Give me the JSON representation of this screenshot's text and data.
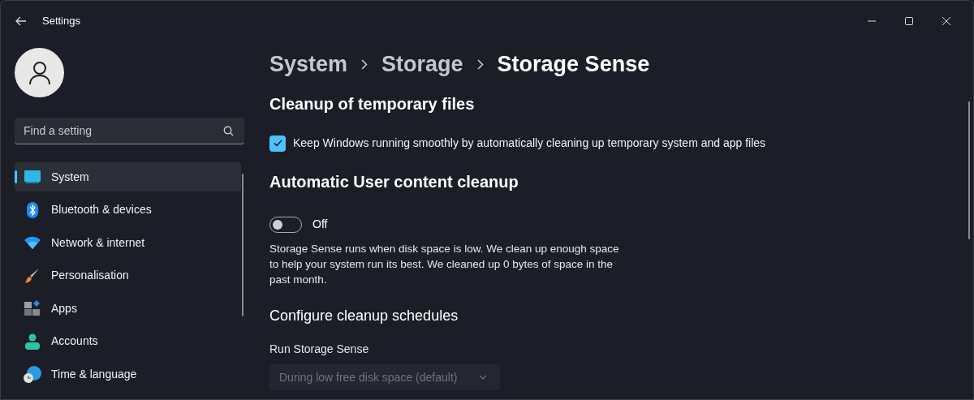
{
  "window": {
    "title": "Settings"
  },
  "search": {
    "placeholder": "Find a setting"
  },
  "nav": [
    {
      "label": "System",
      "selected": true
    },
    {
      "label": "Bluetooth & devices",
      "selected": false
    },
    {
      "label": "Network & internet",
      "selected": false
    },
    {
      "label": "Personalisation",
      "selected": false
    },
    {
      "label": "Apps",
      "selected": false
    },
    {
      "label": "Accounts",
      "selected": false
    },
    {
      "label": "Time & language",
      "selected": false
    }
  ],
  "breadcrumb": [
    "System",
    "Storage",
    "Storage Sense"
  ],
  "sections": [
    {
      "kind": "heading",
      "text": "Cleanup of temporary files"
    },
    {
      "kind": "checkbox",
      "label": "Keep Windows running smoothly by automatically cleaning up temporary system and app files",
      "checked": true
    },
    {
      "kind": "heading",
      "text": "Automatic User content cleanup"
    },
    {
      "kind": "toggle",
      "label": "Off",
      "on": false
    },
    {
      "kind": "paragraph",
      "text": "Storage Sense runs when disk space is low. We clean up enough space to help your system run its best. We cleaned up 0 bytes of space in the past month."
    },
    {
      "kind": "subheading",
      "text": "Configure cleanup schedules"
    },
    {
      "kind": "label",
      "text": "Run Storage Sense"
    },
    {
      "kind": "dropdown",
      "value": "During low free disk space (default)",
      "disabled": true
    }
  ]
}
